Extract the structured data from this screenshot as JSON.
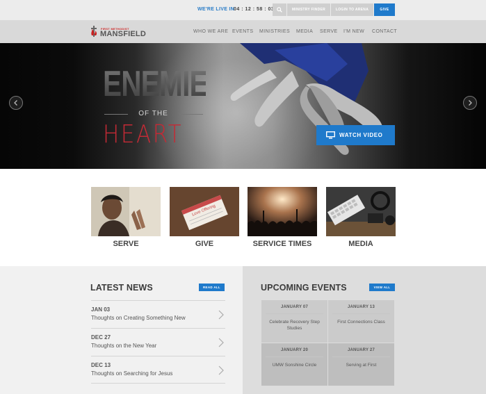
{
  "topbar": {
    "live_label": "WE'RE LIVE IN",
    "countdown": "04 : 12 : 58 : 03",
    "search_icon": "search-icon",
    "ministry_finder": "MINISTRY FINDER",
    "login_arena": "LOGIN TO ARENA",
    "give": "GIVE"
  },
  "logo": {
    "small": "FIRST METHODIST",
    "big": "MANSFIELD"
  },
  "nav": [
    "WHO WE ARE",
    "EVENTS",
    "MINISTRIES",
    "MEDIA",
    "SERVE",
    "I'M NEW",
    "CONTACT"
  ],
  "hero": {
    "title_line1": "ENEMIES",
    "title_line2": "OF THE",
    "title_line3": "HEART",
    "watch_label": "WATCH VIDEO",
    "prev_icon": "chevron-left-icon",
    "next_icon": "chevron-right-icon"
  },
  "tiles": [
    {
      "label": "SERVE",
      "icon": "photo-person-praying"
    },
    {
      "label": "GIVE",
      "icon": "photo-offering-envelope"
    },
    {
      "label": "SERVICE TIMES",
      "icon": "photo-worship-crowd"
    },
    {
      "label": "MEDIA",
      "icon": "photo-keyboard-headphones"
    }
  ],
  "envelope_text": "Love Offering",
  "news": {
    "title": "LATEST NEWS",
    "button": "READ ALL",
    "items": [
      {
        "date": "JAN 03",
        "text": "Thoughts on Creating Something New"
      },
      {
        "date": "DEC 27",
        "text": "Thoughts on the New Year"
      },
      {
        "date": "DEC 13",
        "text": "Thoughts on Searching for Jesus"
      }
    ]
  },
  "events": {
    "title": "UPCOMING EVENTS",
    "button": "VIEW ALL",
    "items": [
      {
        "date": "JANUARY 07",
        "title": "Celebrate Recovery Step Studies"
      },
      {
        "date": "JANUARY 13",
        "title": "First Connections Class"
      },
      {
        "date": "JANUARY 20",
        "title": "UMW Sonshine Circle"
      },
      {
        "date": "JANUARY 27",
        "title": "Serving at First"
      }
    ]
  },
  "colors": {
    "accent": "#1f7acb",
    "heart_red": "#c42a35",
    "live_blue": "#2a7cc7"
  }
}
